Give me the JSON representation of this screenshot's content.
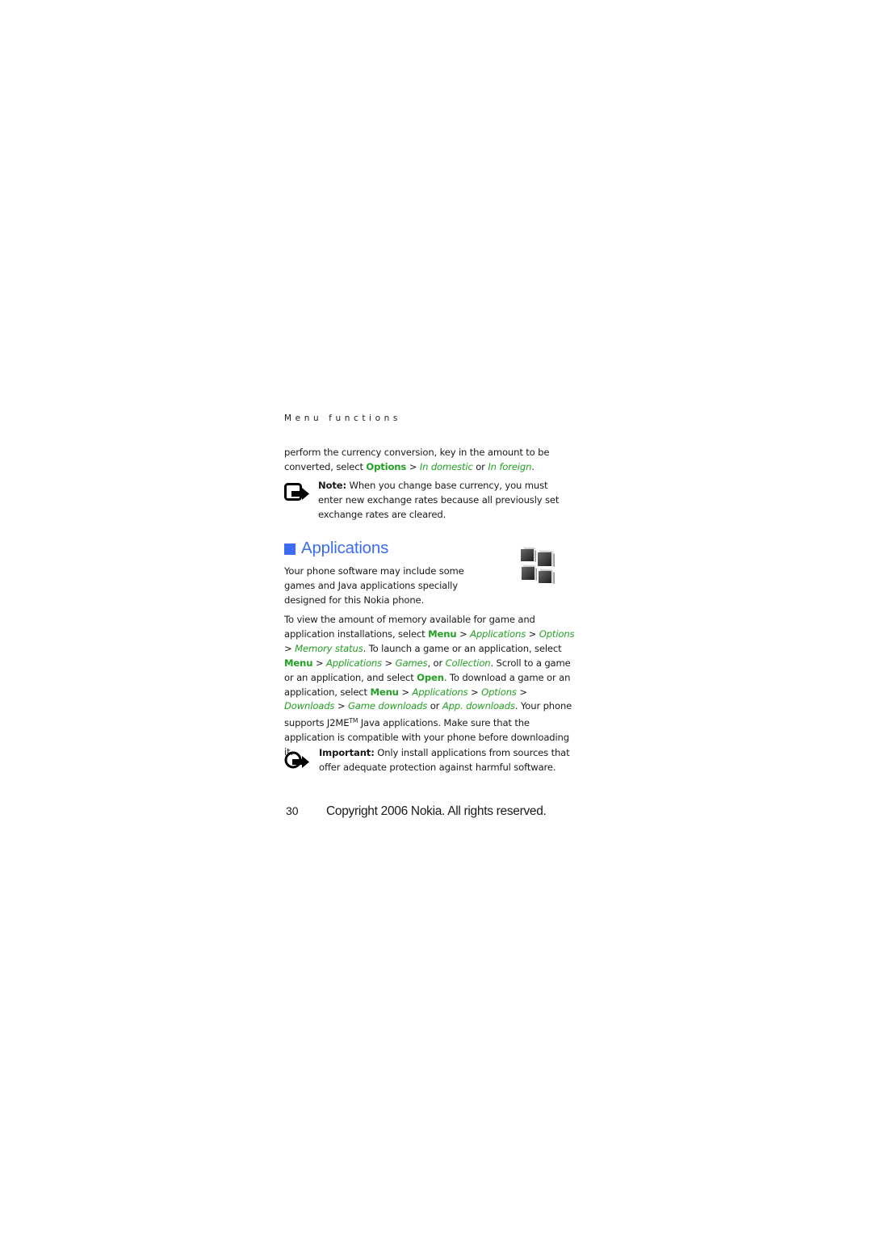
{
  "running_head": "Menu functions",
  "para1": {
    "text_before": "perform the currency conversion, key in the amount to be converted, select ",
    "options": "Options",
    "sep1": " > ",
    "in_domestic": "In domestic",
    "or": " or ",
    "in_foreign": "In foreign",
    "end": "."
  },
  "note": {
    "icon": "note-icon",
    "label": "Note:",
    "text": " When you change base currency, you must enter new exchange rates because all previously set exchange rates are cleared."
  },
  "section": {
    "title": "Applications",
    "icon": "applications-icon",
    "intro": "Your phone software may include some games and Java applications specially designed for this Nokia phone."
  },
  "para2": {
    "t1": "To view the amount of memory available for game and application installations, select ",
    "menu1": "Menu",
    "gt": " > ",
    "applications1": "Applications",
    "options1": "Options",
    "memory_status": "Memory status",
    "t2": ". To launch a game or an application, select ",
    "menu2": "Menu",
    "applications2": "Applications",
    "games": "Games",
    "comma_or": ", or ",
    "collection": "Collection",
    "t3": ". Scroll to a game or an application, and select ",
    "open": "Open",
    "t4": ". To download a game or an application, select ",
    "menu3": "Menu",
    "applications3": "Applications",
    "options3": "Options",
    "downloads": "Downloads",
    "game_downloads": "Game downloads",
    "or": " or ",
    "app_downloads": "App. downloads",
    "t5": ". Your phone supports J2ME",
    "tm": "TM",
    "t6": " Java applications. Make sure that the application is compatible with your phone before downloading it."
  },
  "important": {
    "icon": "important-icon",
    "label": "Important:",
    "text": " Only install applications from sources that offer adequate protection against harmful software."
  },
  "footer": {
    "page_number": "30",
    "copyright": "Copyright  2006 Nokia. All rights reserved."
  },
  "colors": {
    "heading_blue": "#3b6cf2",
    "link_green": "#22a022"
  }
}
